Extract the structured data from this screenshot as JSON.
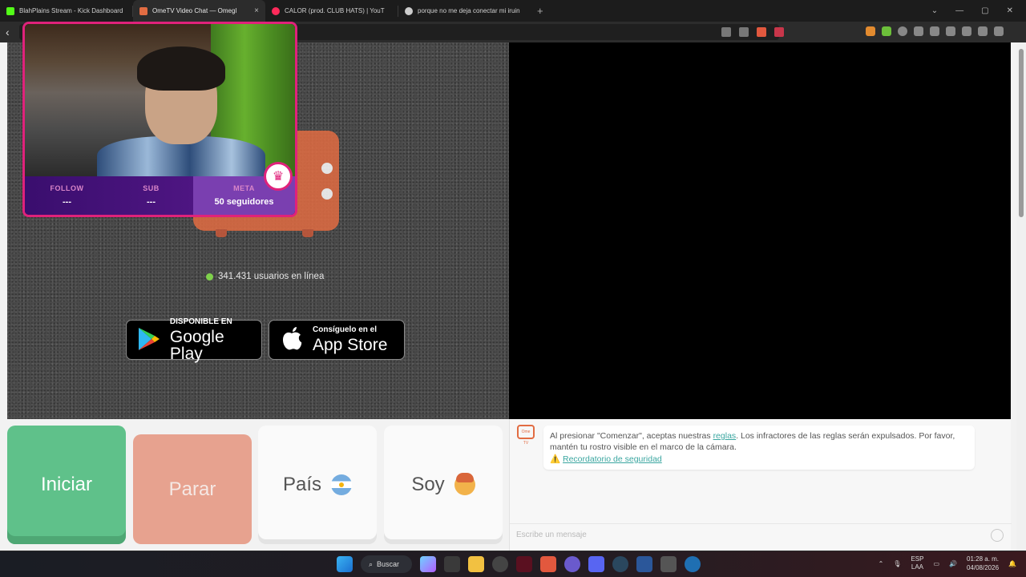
{
  "browser": {
    "tabs": [
      {
        "title": "BlahPlains Stream - Kick Dashboard",
        "icon_color": "#53fc18",
        "active": false
      },
      {
        "title": "OmeTV Video Chat — Omegl",
        "icon_color": "#e26c42",
        "active": true
      },
      {
        "title": "CALOR (prod. CLUB HATS) | YouT",
        "icon_color": "#ff2a5a",
        "active": false
      },
      {
        "title": "porque no me deja conectar mi iruin",
        "icon_color": "#cccccc",
        "active": false
      }
    ],
    "new_tab_symbol": "+",
    "close_symbol": "×"
  },
  "overlay": {
    "stats": [
      {
        "label": "FOLLOW",
        "value": "---"
      },
      {
        "label": "SUB",
        "value": "---"
      },
      {
        "label": "META",
        "value": "50 seguidores"
      }
    ]
  },
  "online": {
    "text": "341.431 usuarios en línea",
    "dot_color": "#7fd14b"
  },
  "stores": {
    "google": {
      "small": "DISPONIBLE EN",
      "big": "Google Play"
    },
    "apple": {
      "small": "Consíguelo en el",
      "big": "App Store"
    }
  },
  "controls": {
    "start": "Iniciar",
    "stop": "Parar",
    "country": "País",
    "me": "Soy"
  },
  "chat": {
    "logo_text": "Ome TV",
    "message_before": "Al presionar \"Comenzar\", aceptas nuestras ",
    "rules_link": "reglas",
    "message_after": ". Los infractores de las reglas serán expulsados. Por favor, mantén tu rostro visible en el marco de la cámara.",
    "warning_icon": "⚠️",
    "safety_link": "Recordatorio de seguridad",
    "input_placeholder": "Escribe un mensaje"
  },
  "taskbar": {
    "search_label": "Buscar",
    "language": "ESP",
    "layout": "LAA",
    "time": "01:28 a. m.",
    "date": "04/08/2026"
  },
  "colors": {
    "accent_pink": "#e0227b",
    "start_green": "#5fc18a",
    "stop_salmon": "#e7a28f",
    "ometv_orange": "#e26c42",
    "link_teal": "#3aa6a0"
  }
}
